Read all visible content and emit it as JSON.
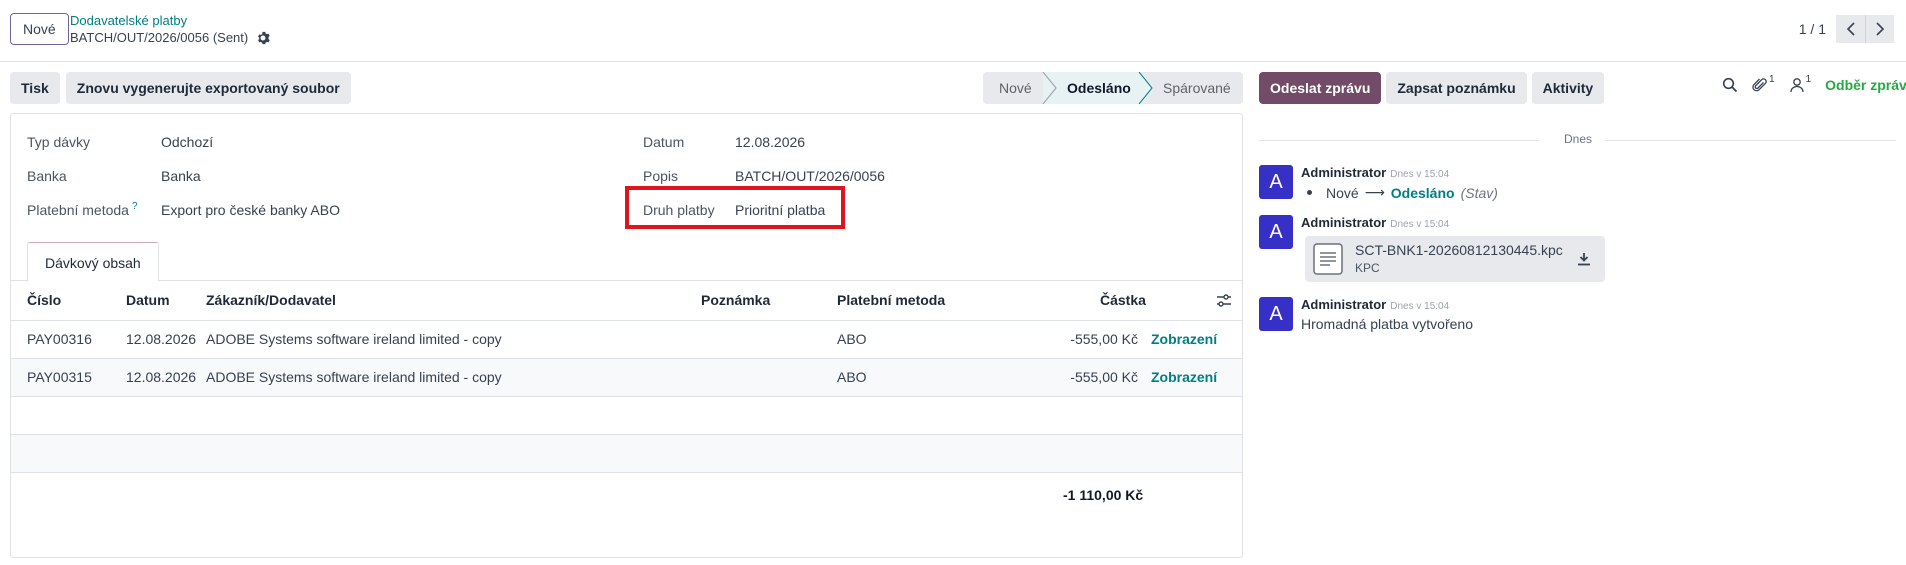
{
  "header": {
    "new_button": "Nové",
    "breadcrumb_parent": "Dodavatelské platby",
    "breadcrumb_current": "BATCH/OUT/2026/0056 (Sent)",
    "pager_value": "1 / 1"
  },
  "actions": {
    "print": "Tisk",
    "regenerate": "Znovu vygenerujte exportovaný soubor"
  },
  "status": {
    "steps": [
      "Nové",
      "Odesláno",
      "Spárované"
    ],
    "active": "Odesláno"
  },
  "chatter_actions": {
    "send_message": "Odeslat zprávu",
    "log_note": "Zapsat poznámku",
    "activities": "Aktivity",
    "attachments_count": "1",
    "followers_count": "1",
    "follow": "Odběr zpráv"
  },
  "form": {
    "batch_type_label": "Typ dávky",
    "batch_type": "Odchozí",
    "bank_label": "Banka",
    "bank": "Banka",
    "payment_method_label": "Platební metoda",
    "payment_method_help": "?",
    "payment_method": "Export pro české banky ABO",
    "date_label": "Datum",
    "date": "12.08.2026",
    "description_label": "Popis",
    "description": "BATCH/OUT/2026/0056",
    "payment_kind_label": "Druh platby",
    "payment_kind": "Prioritní platba"
  },
  "tab": {
    "label": "Dávkový obsah"
  },
  "table": {
    "columns": {
      "number": "Číslo",
      "date": "Datum",
      "partner": "Zákazník/Dodavatel",
      "memo": "Poznámka",
      "method": "Platební metoda",
      "amount": "Částka"
    },
    "rows": [
      {
        "number": "PAY00316",
        "date": "12.08.2026",
        "partner": "ADOBE Systems software ireland limited - copy",
        "memo": "",
        "method": "ABO",
        "amount": "-555,00 Kč",
        "action": "Zobrazení"
      },
      {
        "number": "PAY00315",
        "date": "12.08.2026",
        "partner": "ADOBE Systems software ireland limited - copy",
        "memo": "",
        "method": "ABO",
        "amount": "-555,00 Kč",
        "action": "Zobrazení"
      }
    ],
    "total": "-1 110,00 Kč"
  },
  "chatter": {
    "today": "Dnes",
    "messages": [
      {
        "avatar": "A",
        "author": "Administrator",
        "time": "Dnes v 15:04",
        "old_value": "Nové",
        "new_value": "Odesláno",
        "field": "(Stav)"
      },
      {
        "avatar": "A",
        "author": "Administrator",
        "time": "Dnes v 15:04",
        "attachment_name": "SCT-BNK1-20260812130445.kpc",
        "attachment_ext": "KPC"
      },
      {
        "avatar": "A",
        "author": "Administrator",
        "time": "Dnes v 15:04",
        "body": "Hromadná platba vytvořeno"
      }
    ]
  },
  "colors": {
    "brand": "#714b67",
    "link": "#017e84",
    "highlight": "#e0141e",
    "avatar": "#3730c6",
    "follow": "#28a745"
  }
}
